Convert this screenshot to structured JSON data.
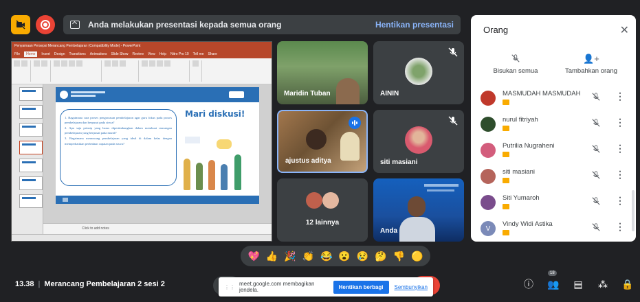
{
  "presenting_bar": {
    "message": "Anda melakukan presentasi kepada semua orang",
    "stop_label": "Hentikan presentasi"
  },
  "slide": {
    "window_title": "Penyamaan Persepsi Merancang Pembelajaran (Compatibility Mode) - PowerPoint",
    "ribbon_tabs": [
      "File",
      "Home",
      "Insert",
      "Design",
      "Transitions",
      "Animations",
      "Slide Show",
      "Review",
      "View",
      "Help",
      "Nitro Pro 10",
      "Tell me",
      "Share"
    ],
    "title": "Mari diskusi!",
    "questions": [
      "1. Bagaimana cara proses pengawasan pembelajaran agar guru fokus pada proses pembelajaran dan berpusat pada siswa?",
      "2. Apa saja prinsip yang harus dipertimbangkan dalam membuat rancangan pembelajaran yang berpusat pada murid?",
      "3. Bagaimana merancang pembelajaran yang ideal di dalam kelas dengan memperhatikan perbedaan capaian pada siswa?"
    ],
    "notes_placeholder": "Click to add notes"
  },
  "tiles": [
    {
      "name": "Maridin Tuban"
    },
    {
      "name": "AININ"
    },
    {
      "name": "ajustus aditya"
    },
    {
      "name": "siti masiani"
    },
    {
      "name": "12 lainnya"
    },
    {
      "name": "Anda"
    }
  ],
  "panel": {
    "title": "Orang",
    "mute_all": "Bisukan semua",
    "add_people": "Tambahkan orang",
    "participants": [
      {
        "name": "MASMUDAH MASMUDAH",
        "color": "#c0392b"
      },
      {
        "name": "nurul fitriyah",
        "color": "#2e4d2c"
      },
      {
        "name": "Putrilia Nugraheni",
        "color": "#d35d7c"
      },
      {
        "name": "siti masiani",
        "color": "#b5645b"
      },
      {
        "name": "Siti Yumaroh",
        "color": "#7a4c8c"
      },
      {
        "name": "Vindy Widi Astika",
        "color": "#7b8ab8",
        "initial": "V"
      }
    ]
  },
  "reactions": [
    "💖",
    "👍",
    "🎉",
    "👏",
    "😂",
    "😮",
    "😢",
    "🤔",
    "👎",
    "🟡"
  ],
  "bottom": {
    "time": "13.38",
    "meeting_title": "Merancang Pembelajaran 2 sesi 2",
    "share_message": "meet.google.com membagikan jendela.",
    "stop_sharing": "Hentikan berbagi",
    "hide": "Sembunyikan",
    "people_count": "18"
  },
  "colors": {
    "accent": "#1a73e8",
    "record": "#ea4335",
    "cam_off": "#f9ab00",
    "bg": "#202124"
  }
}
